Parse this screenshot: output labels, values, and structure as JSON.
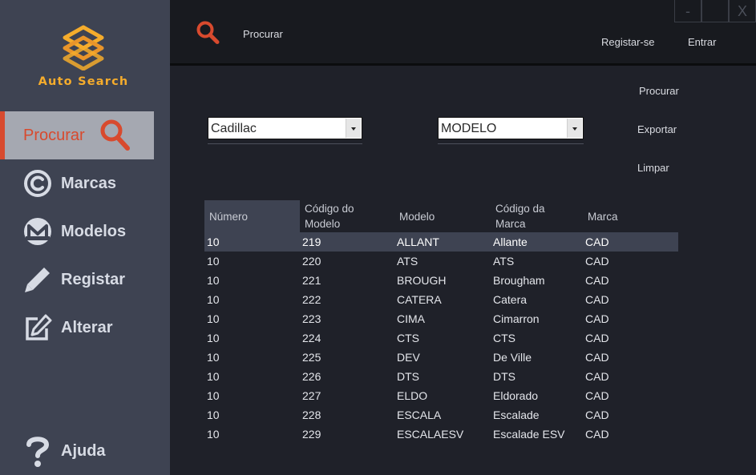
{
  "app": {
    "logo_text": "Auto Search",
    "brand_color": "#f5ac2c",
    "accent_color": "#d84a2e"
  },
  "sidebar": {
    "items": [
      {
        "label": "Procurar",
        "icon": "search-icon",
        "active": true
      },
      {
        "label": "Marcas",
        "icon": "copyright-icon"
      },
      {
        "label": "Modelos",
        "icon": "m-circle-icon"
      },
      {
        "label": "Registar",
        "icon": "pencil-icon"
      },
      {
        "label": "Alterar",
        "icon": "edit-icon"
      }
    ],
    "help": {
      "label": "Ajuda",
      "icon": "question-icon"
    }
  },
  "topbar": {
    "search_label": "Procurar",
    "register_label": "Registar-se",
    "login_label": "Entrar",
    "window_controls": {
      "minimize": "-",
      "close": "X"
    }
  },
  "filters": {
    "brand_select": "Cadillac",
    "field_select": "MODELO"
  },
  "actions": {
    "search": "Procurar",
    "export": "Exportar",
    "clear": "Limpar"
  },
  "table": {
    "columns": [
      {
        "line1": "Número",
        "line2": ""
      },
      {
        "line1": "Código do",
        "line2": "Modelo"
      },
      {
        "line1": "Modelo",
        "line2": ""
      },
      {
        "line1": "Código da",
        "line2": "Marca"
      },
      {
        "line1": "Marca",
        "line2": ""
      }
    ],
    "rows": [
      [
        "10",
        "219",
        "ALLANT",
        "Allante",
        "CAD"
      ],
      [
        "10",
        "220",
        "ATS",
        "ATS",
        "CAD"
      ],
      [
        "10",
        "221",
        "BROUGH",
        "Brougham",
        "CAD"
      ],
      [
        "10",
        "222",
        "CATERA",
        "Catera",
        "CAD"
      ],
      [
        "10",
        "223",
        "CIMA",
        "Cimarron",
        "CAD"
      ],
      [
        "10",
        "224",
        "CTS",
        "CTS",
        "CAD"
      ],
      [
        "10",
        "225",
        "DEV",
        "De Ville",
        "CAD"
      ],
      [
        "10",
        "226",
        "DTS",
        "DTS",
        "CAD"
      ],
      [
        "10",
        "227",
        "ELDO",
        "Eldorado",
        "CAD"
      ],
      [
        "10",
        "228",
        "ESCALA",
        "Escalade",
        "CAD"
      ],
      [
        "10",
        "229",
        "ESCALAESV",
        "Escalade ESV",
        "CAD"
      ]
    ],
    "selected_row": 0
  }
}
